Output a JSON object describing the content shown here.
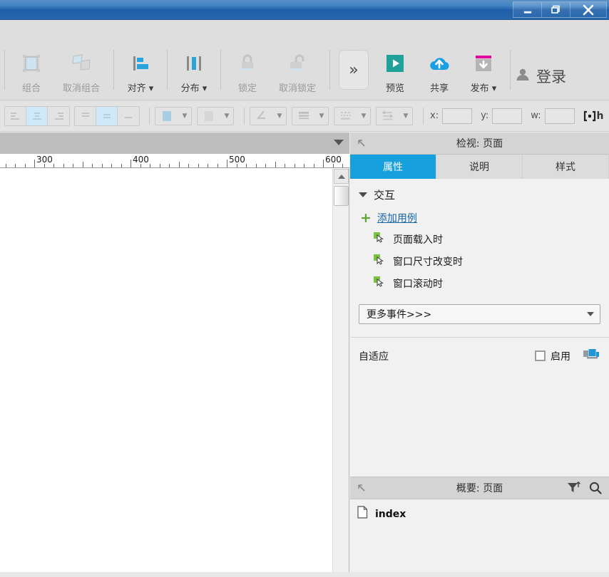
{
  "window": {
    "controls": [
      {
        "name": "minimize",
        "glyph": "minimize-icon"
      },
      {
        "name": "restore",
        "glyph": "restore-icon"
      },
      {
        "name": "close",
        "glyph": "close-icon"
      }
    ]
  },
  "toolbar": {
    "items": [
      {
        "label": "组合",
        "icon": "group-icon",
        "dim": true,
        "dropdown": false
      },
      {
        "label": "取消组合",
        "icon": "ungroup-icon",
        "dim": true,
        "dropdown": false
      },
      {
        "label": "对齐",
        "icon": "align-icon",
        "dim": false,
        "dropdown": true
      },
      {
        "label": "分布",
        "icon": "distribute-icon",
        "dim": false,
        "dropdown": true
      },
      {
        "label": "锁定",
        "icon": "lock-icon",
        "dim": true,
        "dropdown": false
      },
      {
        "label": "取消锁定",
        "icon": "unlock-icon",
        "dim": true,
        "dropdown": false
      },
      {
        "label": "预览",
        "icon": "preview-icon",
        "dim": false,
        "dropdown": false
      },
      {
        "label": "共享",
        "icon": "share-icon",
        "dim": false,
        "dropdown": false
      },
      {
        "label": "发布",
        "icon": "publish-icon",
        "dim": false,
        "dropdown": true
      }
    ],
    "overflow_label": "»",
    "login_label": "登录"
  },
  "formatbar": {
    "x_label": "x:",
    "y_label": "y:",
    "w_label": "w:",
    "h_label": "h",
    "x_value": "",
    "y_value": "",
    "w_value": ""
  },
  "canvas": {
    "ruler_labels": [
      "300",
      "400",
      "500",
      "600"
    ],
    "ruler_positions": [
      48,
      183,
      318,
      453
    ]
  },
  "inspector": {
    "header_title": "检视: 页面",
    "tabs": [
      {
        "label": "属性",
        "active": true
      },
      {
        "label": "说明",
        "active": false
      },
      {
        "label": "样式",
        "active": false
      }
    ],
    "section_title": "交互",
    "add_case_label": "添加用例",
    "events": [
      {
        "label": "页面载入时"
      },
      {
        "label": "窗口尺寸改变时"
      },
      {
        "label": "窗口滚动时"
      }
    ],
    "more_events_label": "更多事件>>>",
    "adaptive_label": "自适应",
    "enable_label": "启用",
    "enable_checked": false
  },
  "outline": {
    "header_title": "概要: 页面",
    "items": [
      {
        "label": "index",
        "icon": "page-icon"
      }
    ]
  },
  "colors": {
    "accent_blue": "#16a0dd",
    "title_blue": "#2a6fb5",
    "toolbar_bg": "#dedede",
    "panel_bg": "#f1f1f1",
    "link_blue": "#1566a8",
    "plus_green": "#5aa832",
    "publish_magenta": "#e6009e",
    "preview_teal": "#21a19a"
  }
}
